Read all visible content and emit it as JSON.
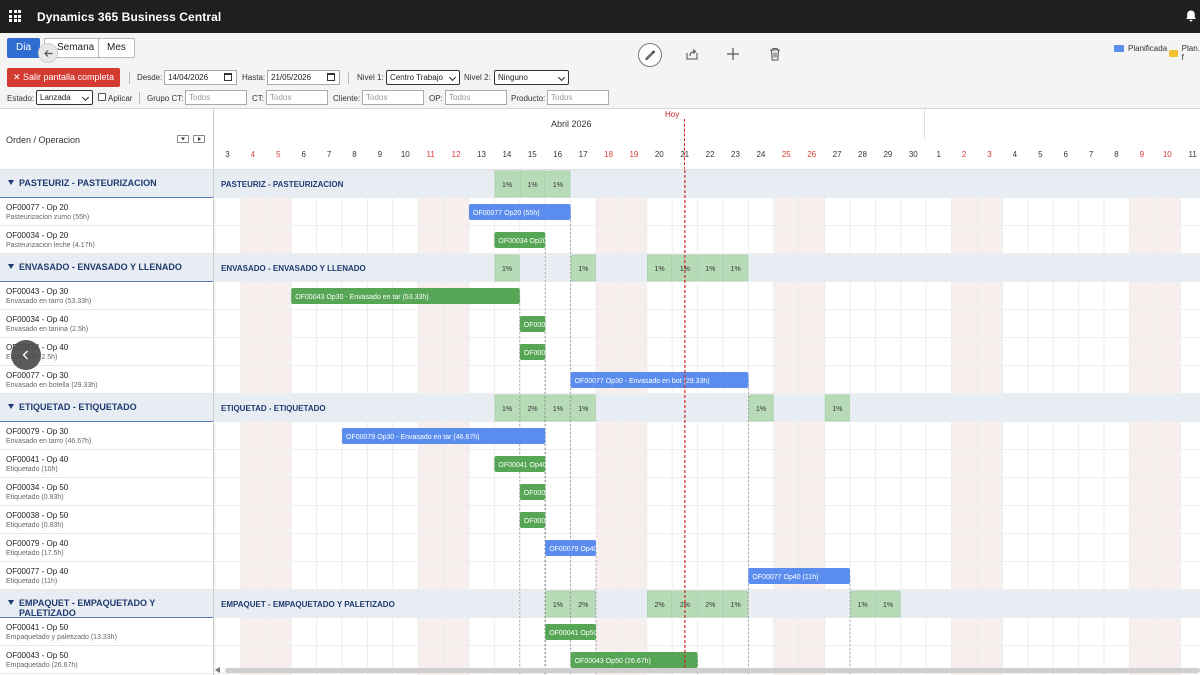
{
  "app": {
    "title": "Dynamics 365 Business Central"
  },
  "toolbar": {
    "views": [
      "Dia",
      "Semana",
      "Mes"
    ],
    "active_view": "Dia",
    "exit_button": "Salir pantalla completa",
    "legend": [
      {
        "label": "Planificada",
        "color": "#5b8def"
      },
      {
        "label": "Plan. f",
        "color": "#f2c12e"
      }
    ]
  },
  "filters": {
    "desde_label": "Desde:",
    "desde_value": "14/04/2026",
    "hasta_label": "Hasta:",
    "hasta_value": "21/05/2026",
    "nivel1_label": "Nivel 1:",
    "nivel1_value": "Centro Trabajo",
    "nivel2_label": "Nivel 2:",
    "nivel2_value": "Ninguno",
    "estado_label": "Estado:",
    "estado_value": "Lanzada",
    "aplicar_label": "Aplicar",
    "grupo_ct_label": "Grupo CT:",
    "grupo_ct_placeholder": "Todos",
    "ct_label": "CT:",
    "ct_placeholder": "Todos",
    "cliente_label": "Cliente:",
    "cliente_placeholder": "Todos",
    "op_label": "OP:",
    "op_placeholder": "Todos",
    "producto_label": "Producto:",
    "producto_placeholder": "Todos"
  },
  "timeline": {
    "column_header": "Orden / Operacion",
    "month": "Abril 2026",
    "today_label": "Hoy",
    "today_day_index": 18,
    "days": [
      {
        "d": "3",
        "we": false
      },
      {
        "d": "4",
        "we": true
      },
      {
        "d": "5",
        "we": true
      },
      {
        "d": "6",
        "we": false
      },
      {
        "d": "7",
        "we": false
      },
      {
        "d": "8",
        "we": false
      },
      {
        "d": "9",
        "we": false
      },
      {
        "d": "10",
        "we": false
      },
      {
        "d": "11",
        "we": true
      },
      {
        "d": "12",
        "we": true
      },
      {
        "d": "13",
        "we": false
      },
      {
        "d": "14",
        "we": false
      },
      {
        "d": "15",
        "we": false
      },
      {
        "d": "16",
        "we": false
      },
      {
        "d": "17",
        "we": false
      },
      {
        "d": "18",
        "we": true
      },
      {
        "d": "19",
        "we": true
      },
      {
        "d": "20",
        "we": false
      },
      {
        "d": "21",
        "we": false
      },
      {
        "d": "22",
        "we": false
      },
      {
        "d": "23",
        "we": false
      },
      {
        "d": "24",
        "we": false
      },
      {
        "d": "25",
        "we": true
      },
      {
        "d": "26",
        "we": true
      },
      {
        "d": "27",
        "we": false
      },
      {
        "d": "28",
        "we": false
      },
      {
        "d": "29",
        "we": false
      },
      {
        "d": "30",
        "we": false
      },
      {
        "d": "1",
        "we": false
      },
      {
        "d": "2",
        "we": true
      },
      {
        "d": "3",
        "we": true
      },
      {
        "d": "4",
        "we": false
      },
      {
        "d": "5",
        "we": false
      },
      {
        "d": "6",
        "we": false
      },
      {
        "d": "7",
        "we": false
      },
      {
        "d": "8",
        "we": false
      },
      {
        "d": "9",
        "we": true
      },
      {
        "d": "10",
        "we": true
      },
      {
        "d": "11",
        "we": false
      }
    ]
  },
  "groups": [
    {
      "label": "PASTEURIZ - PASTEURIZACION",
      "load": [
        {
          "day": 11,
          "text": "1%"
        },
        {
          "day": 12,
          "text": "1%"
        },
        {
          "day": 13,
          "text": "1%"
        }
      ],
      "rows": [
        {
          "title": "OF00077 - Op 20",
          "sub": "Pasteurizacion zumo (55h)",
          "bar": {
            "label": "OF00077 Op20 (55h)",
            "start": 10.0,
            "end": 14.0,
            "color": "#5b8def"
          }
        },
        {
          "title": "OF00034 - Op 20",
          "sub": "Pasteurizacion leche (4.17h)",
          "bar": {
            "label": "OF00034 Op20",
            "start": 11.0,
            "end": 13.0,
            "color": "#56a656"
          }
        }
      ]
    },
    {
      "label": "ENVASADO - ENVASADO Y LLENADO",
      "load": [
        {
          "day": 11,
          "text": "1%"
        },
        {
          "day": 14,
          "text": "1%"
        },
        {
          "day": 17,
          "text": "1%"
        },
        {
          "day": 18,
          "text": "1%"
        },
        {
          "day": 19,
          "text": "1%"
        },
        {
          "day": 20,
          "text": "1%"
        }
      ],
      "rows": [
        {
          "title": "OF00043 - Op 30",
          "sub": "Envasado en tarro (53.33h)",
          "bar": {
            "label": "OF00043 Op30 - Envasado en tar (53.33h)",
            "start": 3.0,
            "end": 12.0,
            "color": "#56a656"
          }
        },
        {
          "title": "OF00034 - Op 40",
          "sub": "Envasado en tanina (2.5h)",
          "bar": {
            "label": "OF00034 Op40",
            "start": 12.0,
            "end": 13.0,
            "color": "#56a656"
          }
        },
        {
          "title": "OF00034 - Op 40",
          "sub": "Envasado (2.5h)",
          "bar": {
            "label": "OF00038 Op30",
            "start": 12.0,
            "end": 13.0,
            "color": "#56a656"
          }
        },
        {
          "title": "OF00077 - Op 30",
          "sub": "Envasado en botella (29.33h)",
          "bar": {
            "label": "OF00077 Op30 - Envasado en bot (29.33h)",
            "start": 14.0,
            "end": 21.0,
            "color": "#5b8def"
          }
        }
      ]
    },
    {
      "label": "ETIQUETAD - ETIQUETADO",
      "load": [
        {
          "day": 11,
          "text": "1%"
        },
        {
          "day": 12,
          "text": "2%"
        },
        {
          "day": 13,
          "text": "1%"
        },
        {
          "day": 14,
          "text": "1%"
        },
        {
          "day": 21,
          "text": "1%"
        },
        {
          "day": 24,
          "text": "1%"
        }
      ],
      "rows": [
        {
          "title": "OF00079 - Op 30",
          "sub": "Envasado en tarro (46.67h)",
          "bar": {
            "label": "OF00079 Op30 - Envasado en tar (46.67h)",
            "start": 5.0,
            "end": 13.0,
            "color": "#5b8def"
          }
        },
        {
          "title": "OF00041 - Op 40",
          "sub": "Etiquetado (10h)",
          "bar": {
            "label": "OF00041 Op40",
            "start": 11.0,
            "end": 13.0,
            "color": "#56a656"
          }
        },
        {
          "title": "OF00034 - Op 50",
          "sub": "Etiquetado (0.83h)",
          "bar": {
            "label": "OF00034 Op50",
            "start": 12.0,
            "end": 13.0,
            "color": "#56a656"
          }
        },
        {
          "title": "OF00038 - Op 50",
          "sub": "Etiquetado (0.83h)",
          "bar": {
            "label": "OF00038 Op50",
            "start": 12.0,
            "end": 13.0,
            "color": "#56a656"
          }
        },
        {
          "title": "OF00079 - Op 40",
          "sub": "Etiquetado (17.5h)",
          "bar": {
            "label": "OF00079 Op40",
            "start": 13.0,
            "end": 15.0,
            "color": "#5b8def"
          }
        },
        {
          "title": "OF00077 - Op 40",
          "sub": "Etiquetado (11h)",
          "bar": {
            "label": "OF00077 Op40 (11h)",
            "start": 21.0,
            "end": 25.0,
            "color": "#5b8def"
          }
        }
      ]
    },
    {
      "label": "EMPAQUET - EMPAQUETADO Y PALETIZADO",
      "load": [
        {
          "day": 13,
          "text": "1%"
        },
        {
          "day": 14,
          "text": "2%"
        },
        {
          "day": 17,
          "text": "2%"
        },
        {
          "day": 18,
          "text": "2%"
        },
        {
          "day": 19,
          "text": "2%"
        },
        {
          "day": 20,
          "text": "1%"
        },
        {
          "day": 25,
          "text": "1%"
        },
        {
          "day": 26,
          "text": "1%"
        }
      ],
      "rows": [
        {
          "title": "OF00041 - Op 50",
          "sub": "Empaquetado y paletizado (13.33h)",
          "bar": {
            "label": "OF00041 Op50",
            "start": 13.0,
            "end": 15.0,
            "color": "#56a656"
          }
        },
        {
          "title": "OF00043 - Op 50",
          "sub": "Empaquetado (26.67h)",
          "bar": {
            "label": "OF00043 Op50 (26.67h)",
            "start": 14.0,
            "end": 19.0,
            "color": "#56a656"
          }
        }
      ]
    }
  ]
}
